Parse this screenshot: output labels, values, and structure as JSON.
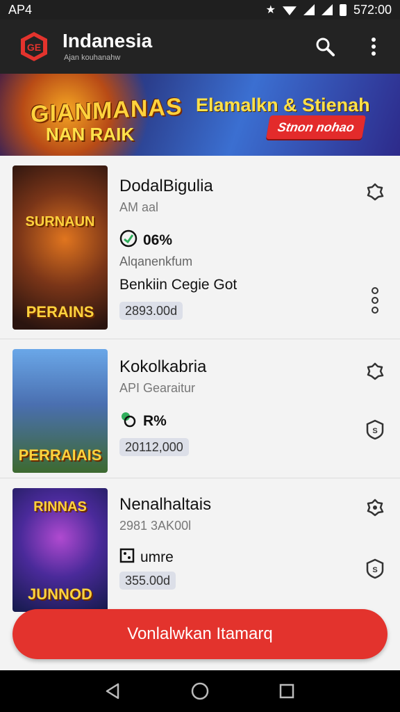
{
  "status_bar": {
    "carrier": "AP4",
    "time": "572:00"
  },
  "app_bar": {
    "title": "Indanesia",
    "subtitle": "Ajan kouhanahw"
  },
  "banner": {
    "logo_line1": "GIANMANAS",
    "logo_line2": "NAN RAIK",
    "headline": "Elamalkn & Stienah",
    "button_label": "Stnon nohao"
  },
  "items": [
    {
      "name": "DodalBigulia",
      "meta": "AM aal",
      "rating": "06%",
      "line1": "Alqanenkfum",
      "line2": "Benkiin Cegie Got",
      "price": "2893.00d",
      "thumb_top": "SURNAUN",
      "thumb_caption": "PERAINS",
      "colors": {
        "thumb_a": "#3b1f1a",
        "thumb_b": "#e0751f"
      }
    },
    {
      "name": "Kokolkabria",
      "meta": "API Gearaitur",
      "rating": "R%",
      "price": "20112,000",
      "thumb_caption": "PERRAIAIS",
      "colors": {
        "thumb_a": "#4a7fc4",
        "thumb_b": "#3d6a2f"
      }
    },
    {
      "name": "Nenalhaltais",
      "meta": "2981 3AK00l",
      "rating": "umre",
      "price": "355.00d",
      "thumb_top": "RINNAS",
      "thumb_caption": "JUNNOD",
      "colors": {
        "thumb_a": "#1c2a6a",
        "thumb_b": "#6a2a9a"
      }
    }
  ],
  "cta": {
    "label": "Vonlalwkan Itamarq"
  },
  "colors": {
    "accent": "#e3332d",
    "appbar": "#232323"
  }
}
